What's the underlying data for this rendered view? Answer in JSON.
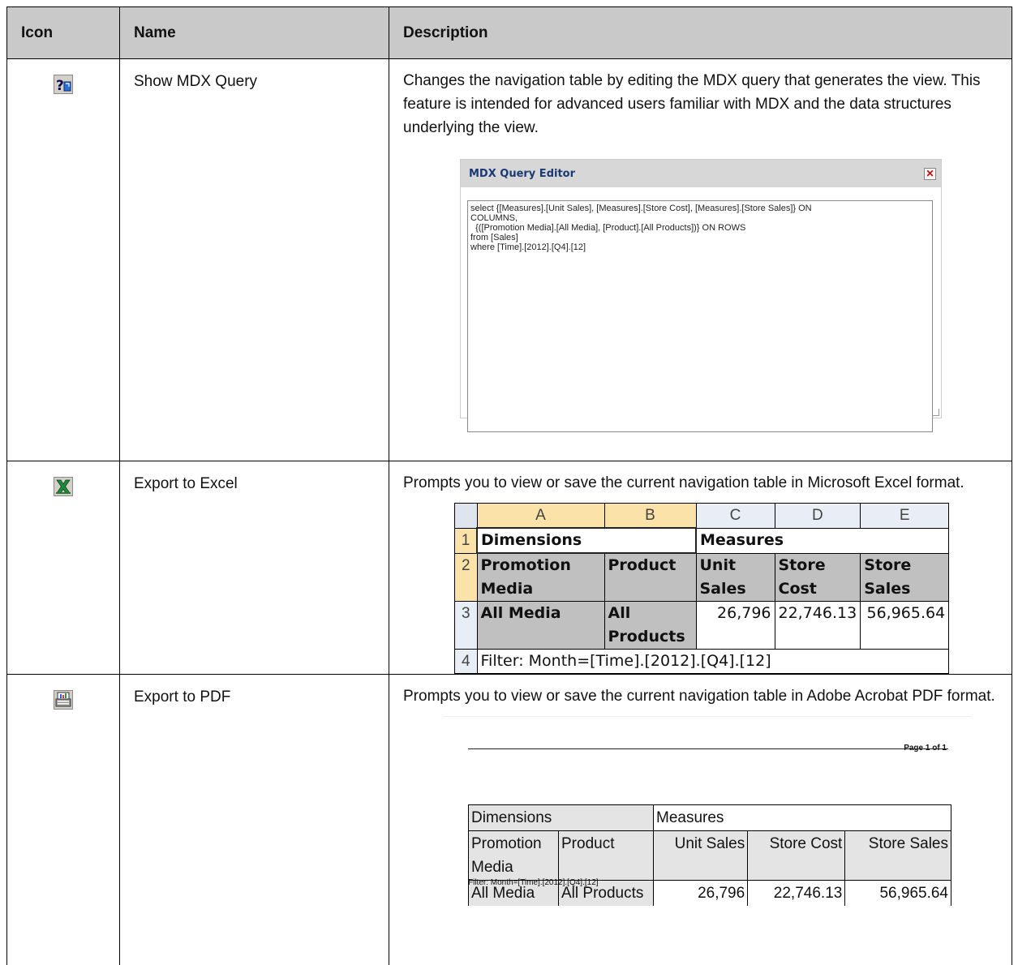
{
  "header": {
    "icon": "Icon",
    "name": "Name",
    "description": "Description"
  },
  "rows": [
    {
      "icon": "mdx-query-icon",
      "name": "Show MDX Query",
      "description": "Changes the navigation table by editing the MDX query that generates the view. This feature is intended for advanced users familiar with MDX and the data structures underlying the view."
    },
    {
      "icon": "excel-export-icon",
      "name": "Export to Excel",
      "description": "Prompts you to view or save the current navigation table in Microsoft Excel format."
    },
    {
      "icon": "pdf-export-icon",
      "name": "Export to PDF",
      "description": "Prompts you to view or save the current navigation table in Adobe Acrobat PDF format."
    }
  ],
  "mdx_editor": {
    "title": "MDX Query Editor",
    "close": "✕",
    "query": "select {[Measures].[Unit Sales], [Measures].[Store Cost], [Measures].[Store Sales]} ON\nCOLUMNS,\n  {([Promotion Media].[All Media], [Product].[All Products])} ON ROWS\nfrom [Sales]\nwhere [Time].[2012].[Q4].[12]"
  },
  "excel": {
    "columns": [
      "A",
      "B",
      "C",
      "D",
      "E"
    ],
    "rows": [
      "1",
      "2",
      "3",
      "4"
    ],
    "r1": {
      "dimensions": "Dimensions",
      "measures": "Measures"
    },
    "r2": [
      "Promotion Media",
      "Product",
      "Unit Sales",
      "Store Cost",
      "Store Sales"
    ],
    "r3": [
      "All Media",
      "All Products",
      "26,796",
      "22,746.13",
      "56,965.64"
    ],
    "r4": "Filter: Month=[Time].[2012].[Q4].[12]"
  },
  "pdf": {
    "page": "Page 1 of 1",
    "r1": {
      "dimensions": "Dimensions",
      "measures": "Measures"
    },
    "r2": [
      "Promotion Media",
      "Product",
      "Unit Sales",
      "Store Cost",
      "Store Sales"
    ],
    "r3": [
      "All Media",
      "All Products",
      "26,796",
      "22,746.13",
      "56,965.64"
    ],
    "filter": "Filter: Month=[Time].[2012].[Q4].[12]"
  }
}
